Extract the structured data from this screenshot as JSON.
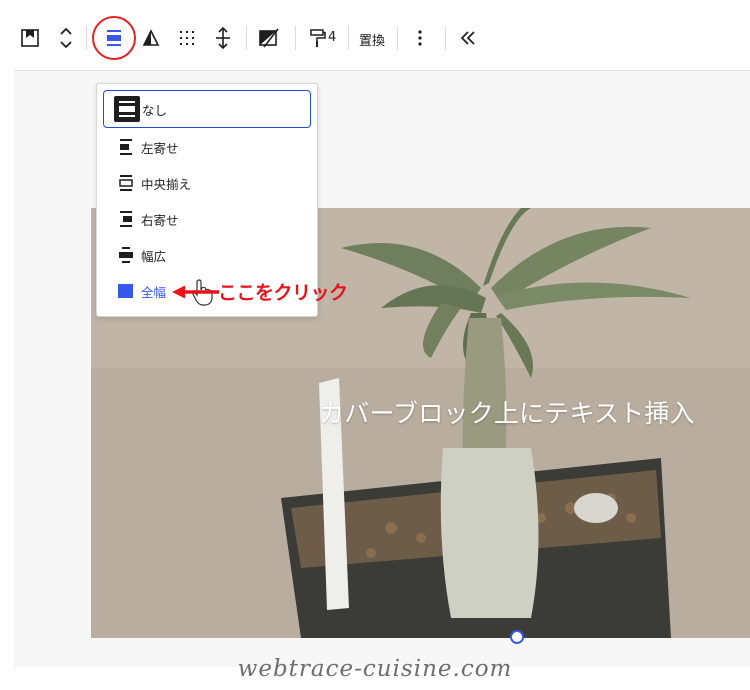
{
  "toolbar": {
    "items": [
      {
        "name": "block-type-icon"
      },
      {
        "name": "move-updown-icon"
      },
      {
        "name": "align-icon",
        "active": true
      },
      {
        "name": "contrast-icon"
      },
      {
        "name": "grid-dots-icon"
      },
      {
        "name": "height-icon"
      },
      {
        "name": "duotone-icon"
      },
      {
        "name": "paint-roller-icon"
      },
      {
        "name": "replace"
      },
      {
        "name": "more-vertical-icon"
      },
      {
        "name": "collapse-double-chevron-icon"
      }
    ],
    "style_count": "4",
    "replace_label": "置換"
  },
  "align_menu": {
    "items": [
      {
        "label": "なし",
        "icon": "align-none-icon",
        "selected": true
      },
      {
        "label": "左寄せ",
        "icon": "align-left-icon"
      },
      {
        "label": "中央揃え",
        "icon": "align-center-icon"
      },
      {
        "label": "右寄せ",
        "icon": "align-right-icon"
      },
      {
        "label": "幅広",
        "icon": "align-wide-icon"
      },
      {
        "label": "全幅",
        "icon": "align-full-icon",
        "accent": true
      }
    ]
  },
  "annotation": {
    "text": "ここをクリック",
    "color": "#e8121b"
  },
  "cover": {
    "text": "カバーブロック上にテキスト挿入"
  },
  "watermark": "webtrace-cuisine.com",
  "colors": {
    "accent": "#3858e9",
    "highlight": "#e02424"
  }
}
